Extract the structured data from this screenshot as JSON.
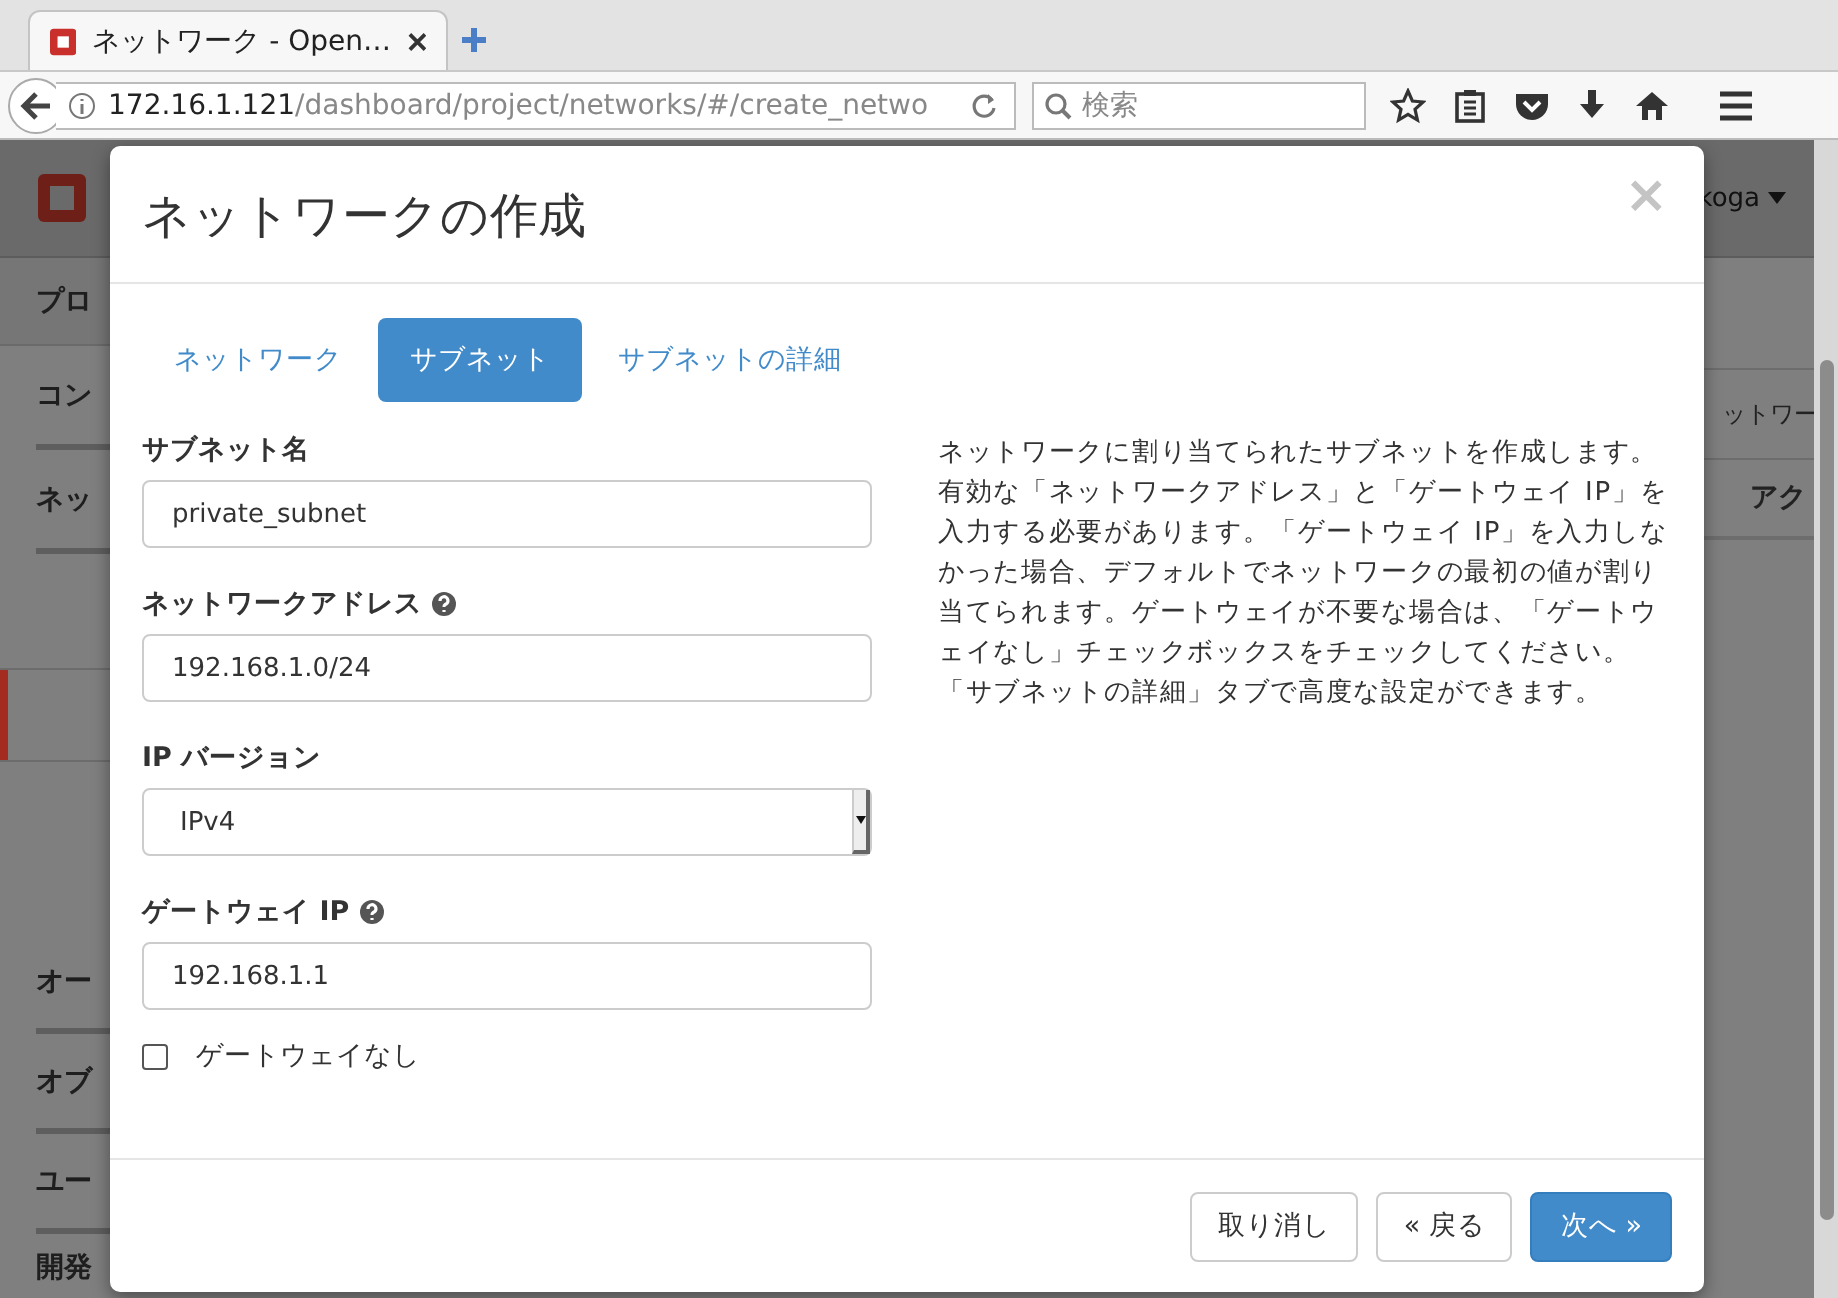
{
  "browser": {
    "tab_title": "ネットワーク - Open…",
    "url_host": "172.16.1.121",
    "url_path": "/dashboard/project/networks/#/create_netwo",
    "search_placeholder": "検索"
  },
  "background": {
    "user": "koga",
    "sidebar_items": [
      {
        "label": "プロ",
        "selected": false
      },
      {
        "label": "コン",
        "selected": false
      },
      {
        "label": "ネッ",
        "selected": false
      },
      {
        "label": "オー",
        "selected": false
      },
      {
        "label": "オブ",
        "selected": false
      },
      {
        "label": "ユー",
        "selected": false
      },
      {
        "label": "開発",
        "selected": false
      }
    ],
    "table_headers": [
      "ットワー",
      "アク"
    ]
  },
  "dialog": {
    "title": "ネットワークの作成",
    "close": "×",
    "tabs": [
      {
        "label": "ネットワーク",
        "selected": false
      },
      {
        "label": "サブネット",
        "selected": true
      },
      {
        "label": "サブネットの詳細",
        "selected": false
      }
    ],
    "fields": [
      {
        "kind": "text",
        "label": "サブネット名",
        "help": false,
        "value": "private_subnet"
      },
      {
        "kind": "text",
        "label": "ネットワークアドレス",
        "help": true,
        "value": "192.168.1.0/24"
      },
      {
        "kind": "select",
        "label": "IP バージョン",
        "help": false,
        "value": "IPv4"
      },
      {
        "kind": "text",
        "label": "ゲートウェイ IP",
        "help": true,
        "value": "192.168.1.1"
      }
    ],
    "checkbox": {
      "label": "ゲートウェイなし",
      "checked": false
    },
    "description": "ネットワークに割り当てられたサブネットを作成します。有効な「ネットワークアドレス」と「ゲートウェイ IP」を入力する必要があります。「ゲートウェイ IP」を入力しなかった場合、デフォルトでネットワークの最初の値が割り当てられます。ゲートウェイが不要な場合は、「ゲートウェイなし」チェックボックスをチェックしてください。「サブネットの詳細」タブで高度な設定ができます。",
    "buttons": [
      {
        "label": "取り消し",
        "kind": "default"
      },
      {
        "label": "« 戻る",
        "kind": "default"
      },
      {
        "label": "次へ »",
        "kind": "primary"
      }
    ]
  }
}
